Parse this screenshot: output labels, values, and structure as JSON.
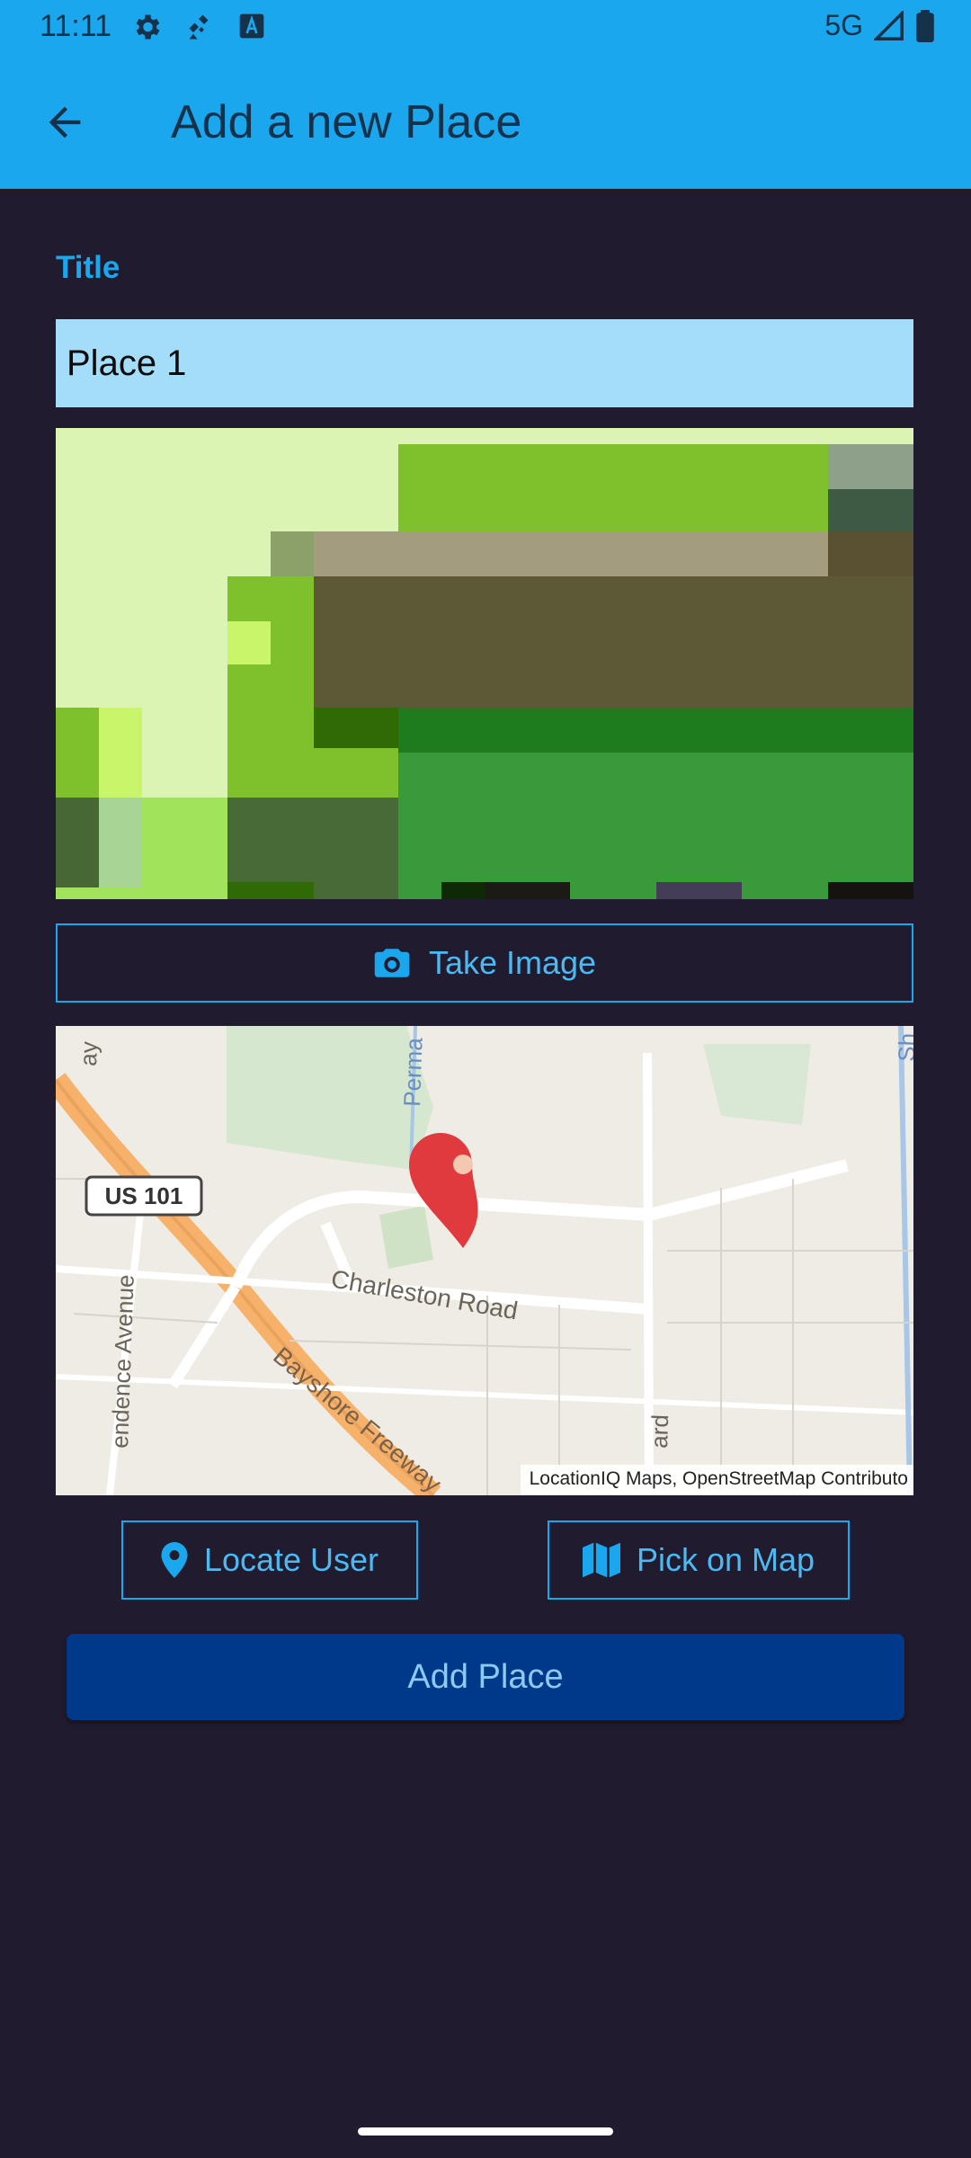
{
  "status_bar": {
    "time": "11:11",
    "network": "5G"
  },
  "app_bar": {
    "title": "Add a new Place",
    "back_icon": "arrow-back-icon"
  },
  "form": {
    "title_label": "Title",
    "title_value": "Place 1"
  },
  "buttons": {
    "take_image": "Take Image",
    "locate_user": "Locate User",
    "pick_on_map": "Pick on Map",
    "add_place": "Add Place"
  },
  "map": {
    "labels": {
      "highway": "US 101",
      "road": "Charleston Road",
      "freeway": "Bayshore Freeway",
      "avenue": "endence Avenue",
      "perma": "Perma",
      "ard": "ard",
      "ay": "ay",
      "st": "Sh"
    },
    "attribution": "LocationIQ Maps, OpenStreetMap Contributo"
  },
  "colors": {
    "app_bar": "#1aa7ee",
    "background": "#201b2e",
    "accent": "#1aa7ee",
    "input_bg": "#a4ddfa",
    "primary_button": "#00398a",
    "pin": "#e03a3e"
  }
}
